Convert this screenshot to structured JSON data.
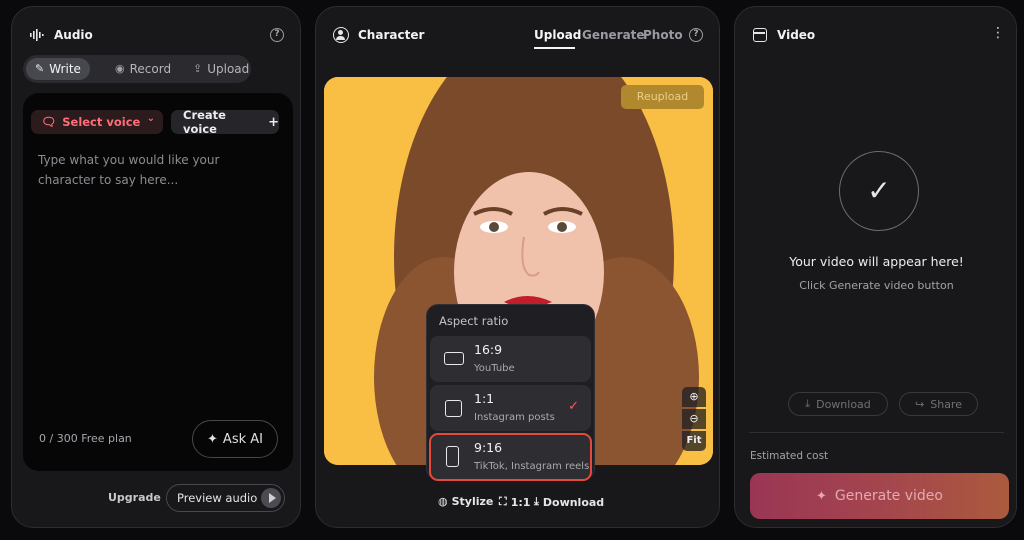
{
  "audio": {
    "title": "Audio",
    "tabs": [
      {
        "label": "Write",
        "icon": "pencil-off-icon"
      },
      {
        "label": "Record",
        "icon": "record-icon"
      },
      {
        "label": "Upload",
        "icon": "upload-icon"
      }
    ],
    "select_voice_label": "Select voice",
    "create_voice_label": "Create voice",
    "text_placeholder": "Type what you would like your character to say here...",
    "counter": "0 / 300  Free plan",
    "ask_ai_label": "Ask AI",
    "upgrade_label": "Upgrade",
    "preview_label": "Preview audio"
  },
  "character": {
    "title": "Character",
    "tabs": [
      {
        "label": "Upload",
        "active": true
      },
      {
        "label": "Generate",
        "active": false
      },
      {
        "label": "Photo",
        "active": false
      }
    ],
    "reupload_label": "Reupload",
    "zoom": {
      "fit_label": "Fit"
    },
    "aspect_menu": {
      "title": "Aspect ratio",
      "options": [
        {
          "label": "16:9",
          "sub": "YouTube",
          "selected": false,
          "checked": false
        },
        {
          "label": "1:1",
          "sub": "Instagram posts",
          "selected": false,
          "checked": true
        },
        {
          "label": "9:16",
          "sub": "TikTok, Instagram reels",
          "selected": true,
          "checked": false
        }
      ]
    },
    "toolbar": {
      "stylize_label": "Stylize",
      "ratio_label": "1:1",
      "download_label": "Download"
    }
  },
  "video": {
    "title": "Video",
    "empty_title": "Your video will appear here!",
    "empty_sub": "Click Generate video button",
    "download_label": "Download",
    "share_label": "Share",
    "estimated_cost_label": "Estimated cost",
    "generate_label": "Generate video"
  },
  "colors": {
    "accent_red": "#ff6d78",
    "menu_highlight": "#e34a3d",
    "photo_bg": "#f9bf44",
    "generate_gradient": [
      "#9a3654",
      "#ab5a3e"
    ]
  }
}
